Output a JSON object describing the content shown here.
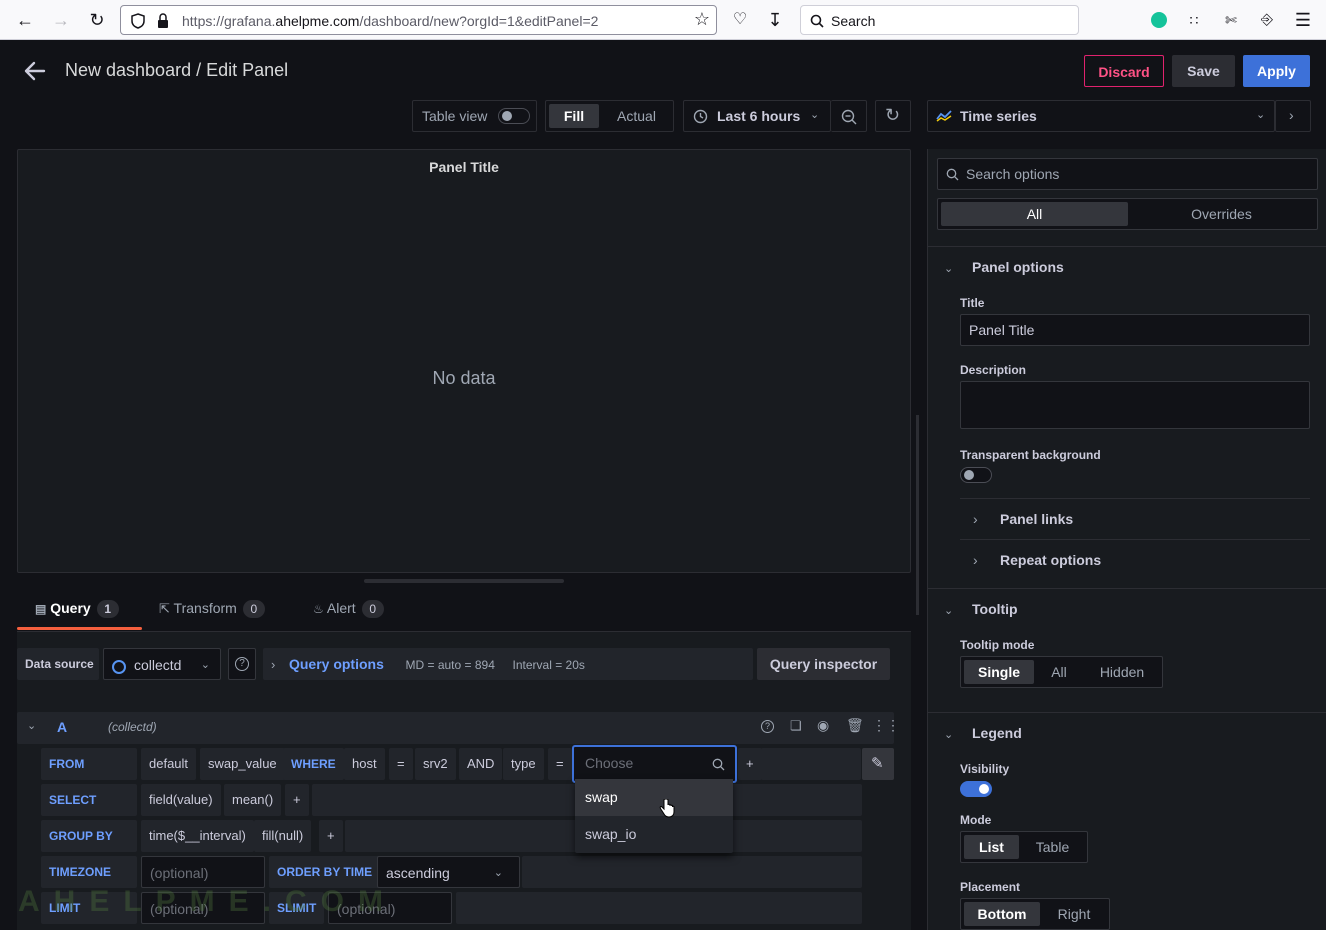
{
  "browser": {
    "url_prefix": "https://grafana.",
    "url_domain": "ahelpme.com",
    "url_path": "/dashboard/new?orgId=1&editPanel=2",
    "search_placeholder": "Search"
  },
  "header": {
    "title": "New dashboard / Edit Panel",
    "discard_label": "Discard",
    "save_label": "Save",
    "apply_label": "Apply"
  },
  "toolbar": {
    "table_view_label": "Table view",
    "fill_label": "Fill",
    "actual_label": "Actual",
    "time_range_label": "Last 6 hours",
    "visualization_label": "Time series"
  },
  "panel": {
    "title": "Panel Title",
    "no_data": "No data"
  },
  "tabs": [
    {
      "label": "Query",
      "count": "1"
    },
    {
      "label": "Transform",
      "count": "0"
    },
    {
      "label": "Alert",
      "count": "0"
    }
  ],
  "query_bar": {
    "datasource_label": "Data source",
    "datasource_value": "collectd",
    "query_options_label": "Query options",
    "md_text": "MD = auto = 894",
    "interval_text": "Interval = 20s",
    "inspector_label": "Query inspector"
  },
  "query": {
    "ref_id": "A",
    "datasource_hint": "(collectd)",
    "from_kw": "FROM",
    "from_policy": "default",
    "from_measurement": "swap_value",
    "where_kw": "WHERE",
    "tag1": "host",
    "op1": "=",
    "val1": "srv2",
    "and_kw": "AND",
    "tag2": "type",
    "op2": "=",
    "choose_placeholder": "Choose",
    "plus": "+",
    "select_kw": "SELECT",
    "select_field": "field(value)",
    "select_fn": "mean()",
    "group_kw": "GROUP BY",
    "group_time": "time($__interval)",
    "group_fill": "fill(null)",
    "timezone_kw": "TIMEZONE",
    "timezone_placeholder": "(optional)",
    "orderby_kw": "ORDER BY TIME",
    "orderby_value": "ascending",
    "limit_kw": "LIMIT",
    "limit_placeholder": "(optional)",
    "slimit_kw": "SLIMIT",
    "slimit_placeholder": "(optional)",
    "dropdown_options": [
      "swap",
      "swap_io"
    ]
  },
  "options": {
    "search_placeholder": "Search options",
    "all_tab": "All",
    "overrides_tab": "Overrides",
    "panel_options_title": "Panel options",
    "title_label": "Title",
    "title_value": "Panel Title",
    "description_label": "Description",
    "transparent_label": "Transparent background",
    "panel_links": "Panel links",
    "repeat_options": "Repeat options",
    "tooltip_title": "Tooltip",
    "tooltip_mode_label": "Tooltip mode",
    "tooltip_modes": [
      "Single",
      "All",
      "Hidden"
    ],
    "legend_title": "Legend",
    "visibility_label": "Visibility",
    "mode_label": "Mode",
    "modes": [
      "List",
      "Table"
    ],
    "placement_label": "Placement",
    "placements": [
      "Bottom",
      "Right"
    ]
  },
  "watermark": "AHELPME.COM"
}
